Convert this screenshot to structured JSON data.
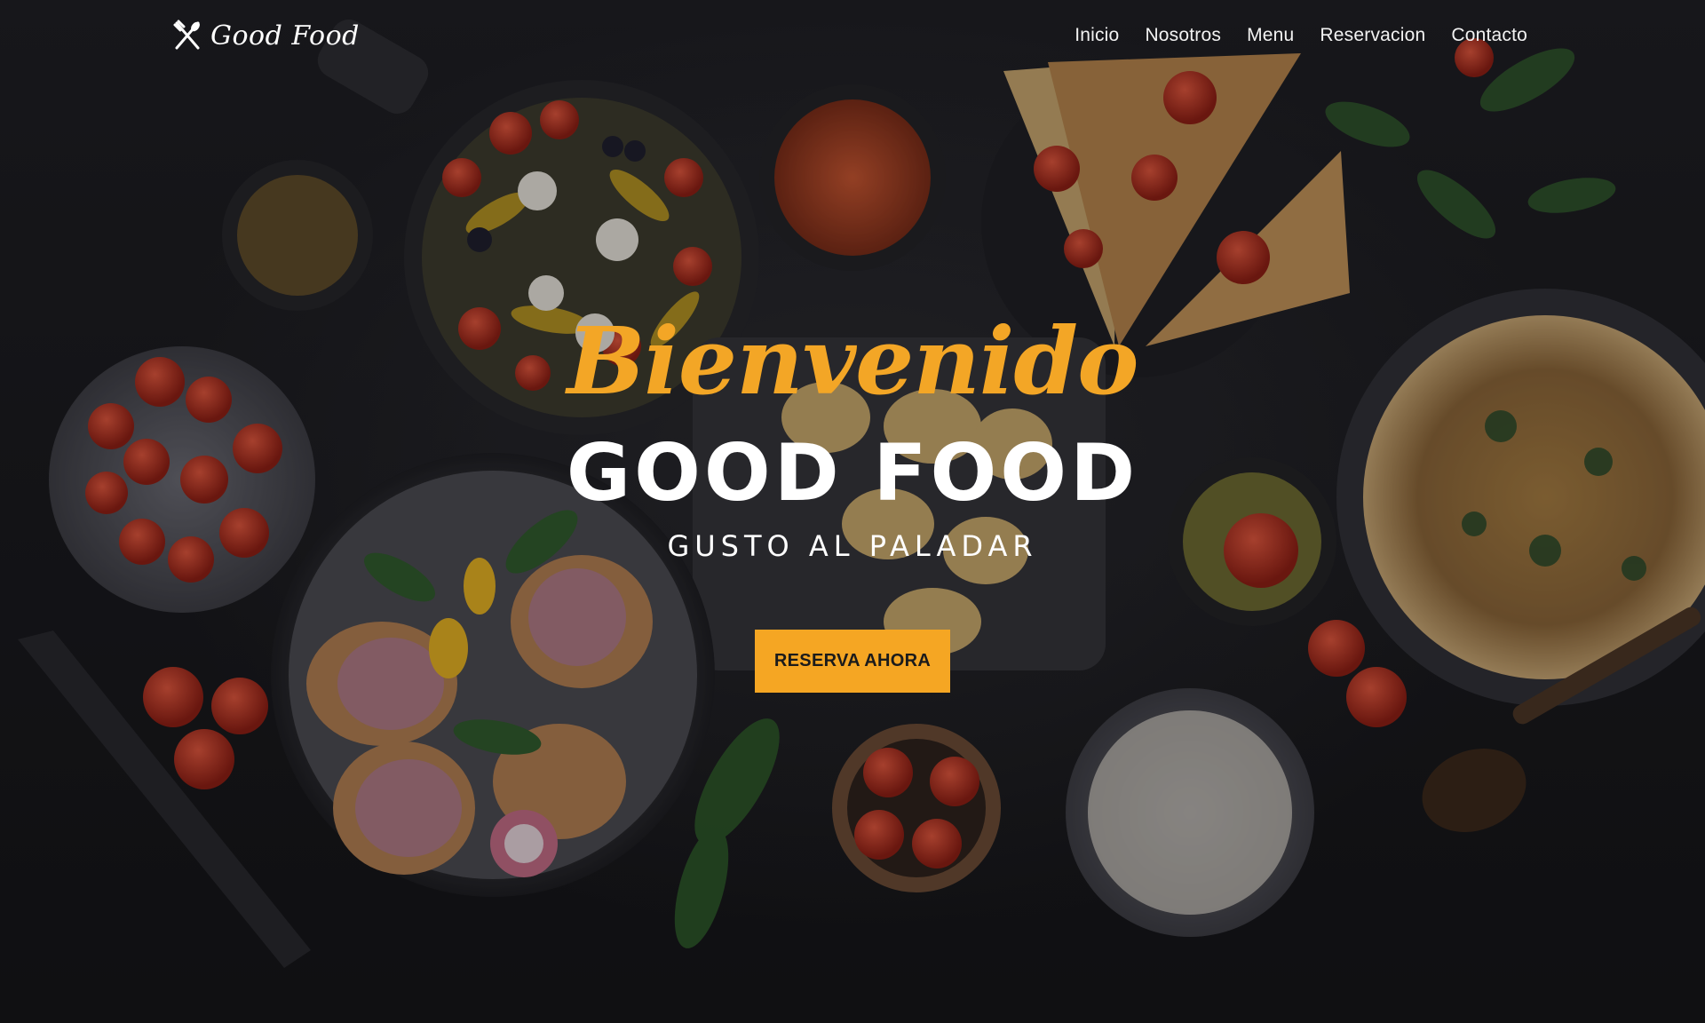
{
  "brand": {
    "name": "Good Food",
    "icon": "fork-knife-icon"
  },
  "nav": {
    "items": [
      {
        "label": "Inicio"
      },
      {
        "label": "Nosotros"
      },
      {
        "label": "Menu"
      },
      {
        "label": "Reservacion"
      },
      {
        "label": "Contacto"
      }
    ]
  },
  "hero": {
    "welcome": "Bienvenido",
    "title": "GOOD FOOD",
    "tagline": "GUSTO AL PALADAR",
    "cta_label": "RESERVA AHORA"
  },
  "colors": {
    "accent": "#f5a623",
    "script": "#f3a626",
    "background": "#17171a",
    "text": "#ffffff"
  }
}
